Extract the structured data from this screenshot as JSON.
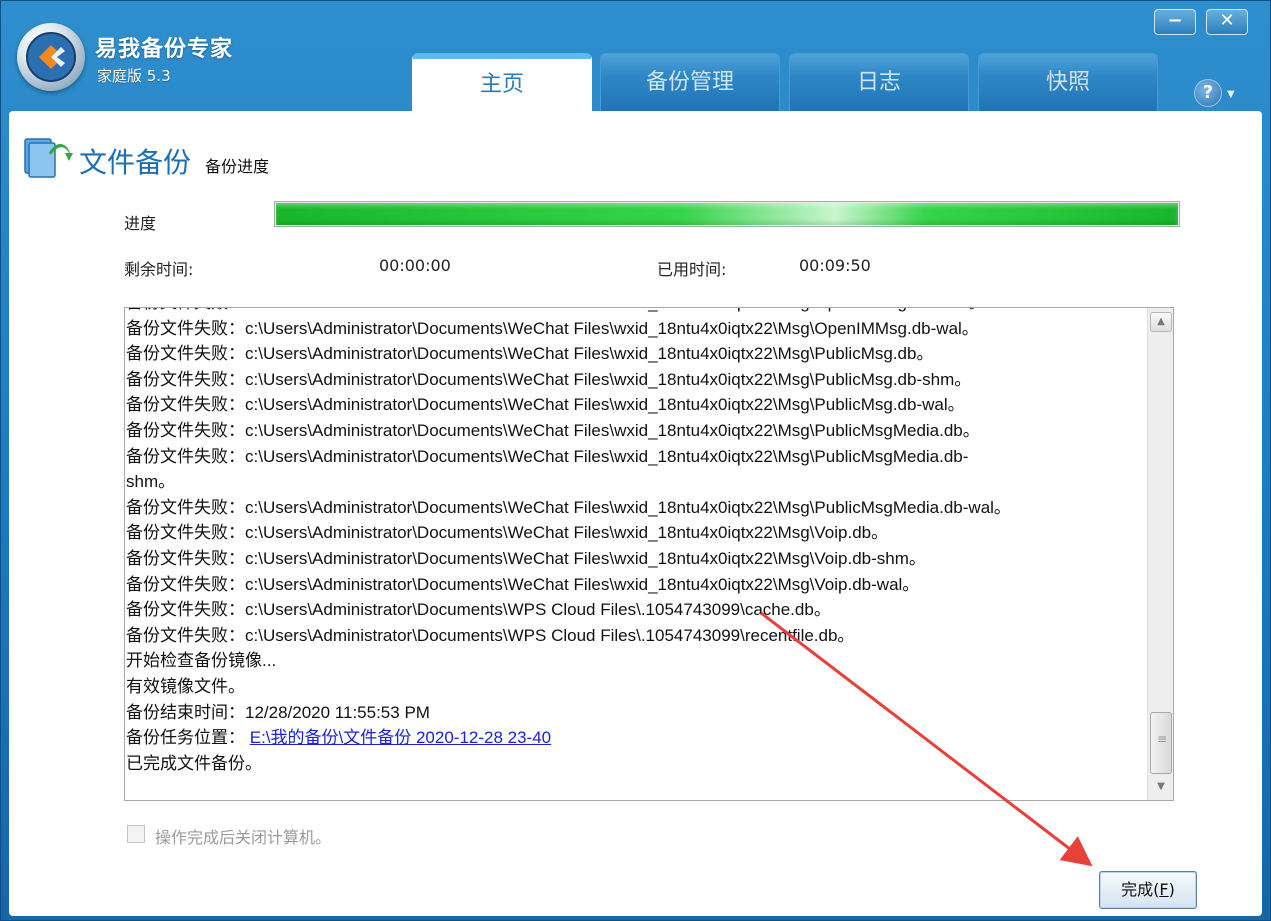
{
  "app": {
    "title": "易我备份专家",
    "edition": "家庭版 5.3"
  },
  "window_controls": {
    "minimize_glyph": "−",
    "close_glyph": "✕"
  },
  "tabs": [
    {
      "label": "主页",
      "active": true
    },
    {
      "label": "备份管理",
      "active": false
    },
    {
      "label": "日志",
      "active": false
    },
    {
      "label": "快照",
      "active": false
    }
  ],
  "help": {
    "glyph": "?",
    "caret": "▼"
  },
  "section": {
    "icon": "file-backup-icon",
    "title": "文件备份",
    "subtitle": "备份进度"
  },
  "progress": {
    "label": "进度",
    "value_percent": 100,
    "remaining_label": "剩余时间:",
    "remaining_value": "00:00:00",
    "elapsed_label": "已用时间:",
    "elapsed_value": "00:09:50"
  },
  "log": {
    "lines": [
      "备份文件失败：c:\\Users\\Administrator\\Documents\\WeChat Files\\wxid_18ntu4x0iqtx22\\Msg\\OpenIMMsg.db-shm。",
      "备份文件失败：c:\\Users\\Administrator\\Documents\\WeChat Files\\wxid_18ntu4x0iqtx22\\Msg\\OpenIMMsg.db-wal。",
      "备份文件失败：c:\\Users\\Administrator\\Documents\\WeChat Files\\wxid_18ntu4x0iqtx22\\Msg\\PublicMsg.db。",
      "备份文件失败：c:\\Users\\Administrator\\Documents\\WeChat Files\\wxid_18ntu4x0iqtx22\\Msg\\PublicMsg.db-shm。",
      "备份文件失败：c:\\Users\\Administrator\\Documents\\WeChat Files\\wxid_18ntu4x0iqtx22\\Msg\\PublicMsg.db-wal。",
      "备份文件失败：c:\\Users\\Administrator\\Documents\\WeChat Files\\wxid_18ntu4x0iqtx22\\Msg\\PublicMsgMedia.db。",
      "备份文件失败：c:\\Users\\Administrator\\Documents\\WeChat Files\\wxid_18ntu4x0iqtx22\\Msg\\PublicMsgMedia.db-",
      "shm。",
      "备份文件失败：c:\\Users\\Administrator\\Documents\\WeChat Files\\wxid_18ntu4x0iqtx22\\Msg\\PublicMsgMedia.db-wal。",
      "备份文件失败：c:\\Users\\Administrator\\Documents\\WeChat Files\\wxid_18ntu4x0iqtx22\\Msg\\Voip.db。",
      "备份文件失败：c:\\Users\\Administrator\\Documents\\WeChat Files\\wxid_18ntu4x0iqtx22\\Msg\\Voip.db-shm。",
      "备份文件失败：c:\\Users\\Administrator\\Documents\\WeChat Files\\wxid_18ntu4x0iqtx22\\Msg\\Voip.db-wal。",
      "备份文件失败：c:\\Users\\Administrator\\Documents\\WPS Cloud Files\\.1054743099\\cache.db。",
      "备份文件失败：c:\\Users\\Administrator\\Documents\\WPS Cloud Files\\.1054743099\\recentfile.db。",
      "开始检查备份镜像...",
      "有效镜像文件。",
      "备份结束时间：12/28/2020 11:55:53 PM"
    ],
    "location_label": "备份任务位置：",
    "location_link": "E:\\我的备份\\文件备份 2020-12-28 23-40",
    "done_line": "已完成文件备份。"
  },
  "shutdown_checkbox": {
    "label": "操作完成后关闭计算机。",
    "checked": false
  },
  "finish_button": {
    "label": "完成(",
    "accel": "F",
    "label_end": ")"
  },
  "colors": {
    "titlebar": "#1c78bc",
    "progress": "#17b72b",
    "link": "#1a23d6",
    "annotation_arrow": "#e8403a"
  }
}
